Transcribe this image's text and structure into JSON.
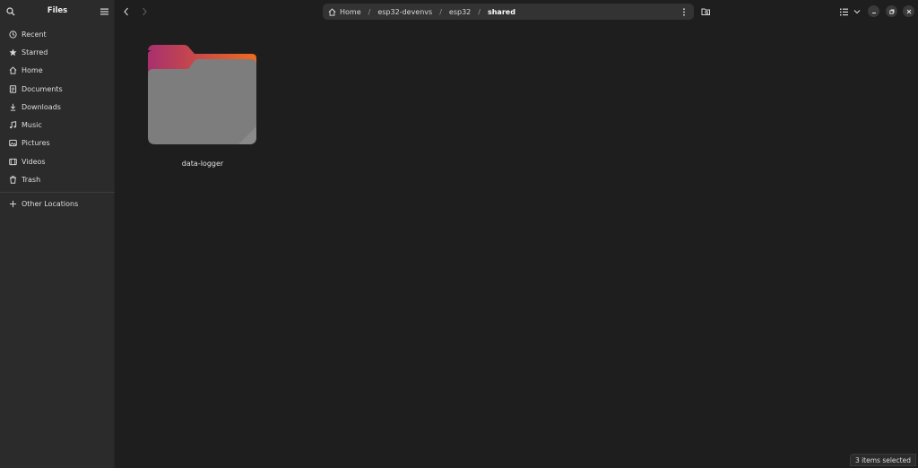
{
  "app": {
    "title": "Files"
  },
  "sidebar": {
    "items": [
      {
        "label": "Recent",
        "icon": "clock-icon"
      },
      {
        "label": "Starred",
        "icon": "star-icon"
      },
      {
        "label": "Home",
        "icon": "home-icon"
      },
      {
        "label": "Documents",
        "icon": "document-icon"
      },
      {
        "label": "Downloads",
        "icon": "download-icon"
      },
      {
        "label": "Music",
        "icon": "music-icon"
      },
      {
        "label": "Pictures",
        "icon": "picture-icon"
      },
      {
        "label": "Videos",
        "icon": "video-icon"
      },
      {
        "label": "Trash",
        "icon": "trash-icon"
      }
    ],
    "other_locations": "Other Locations"
  },
  "pathbar": {
    "crumbs": [
      "Home",
      "esp32-devenvs",
      "esp32",
      "shared"
    ],
    "separator": "/"
  },
  "content": {
    "items": [
      {
        "name": "data-logger",
        "type": "folder"
      }
    ]
  },
  "status": {
    "text": "3 items selected"
  },
  "colors": {
    "window_bg": "#1e1e1e",
    "sidebar_bg": "#2b2b2b",
    "pathbar_bg": "#333333",
    "folder_back_start": "#a8306e",
    "folder_back_end": "#f06a1c",
    "folder_front": "#7d7d7d"
  }
}
